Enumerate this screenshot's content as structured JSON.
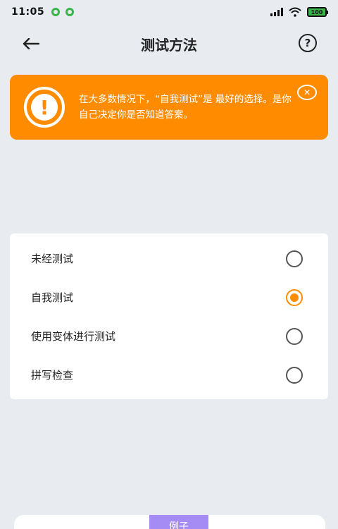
{
  "status_bar": {
    "time": "11:05",
    "battery": "100"
  },
  "header": {
    "title": "测试方法",
    "back_icon": "arrow-left-icon",
    "help_icon": "question-circle-icon",
    "help_glyph": "?"
  },
  "banner": {
    "icon": "exclamation-circle-icon",
    "icon_glyph": "!",
    "text": "在大多数情况下，“自我测试”是 最好的选择。是你自己决定你是否知道答案。",
    "close_glyph": "✕",
    "color": "#ff8c00"
  },
  "options": [
    {
      "label": "未经测试",
      "selected": false
    },
    {
      "label": "自我测试",
      "selected": true
    },
    {
      "label": "使用变体进行测试",
      "selected": false
    },
    {
      "label": "拼写检查",
      "selected": false
    }
  ],
  "bottom": {
    "example_tab": "例子"
  },
  "colors": {
    "accent": "#ff8c00",
    "tab": "#a58cf5",
    "background": "#e8ebf0"
  }
}
